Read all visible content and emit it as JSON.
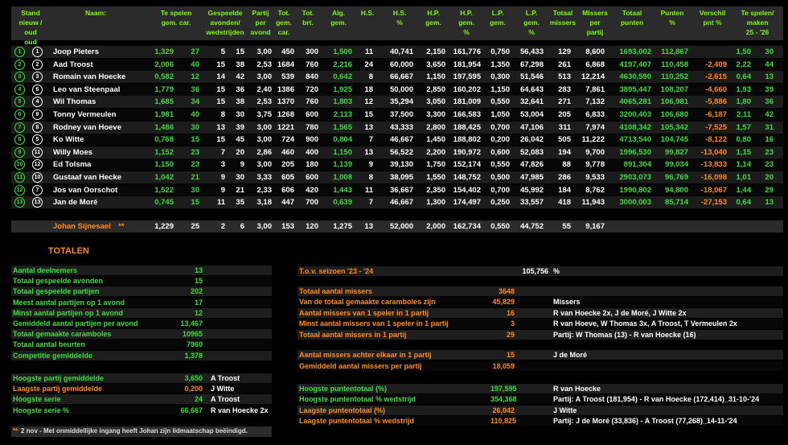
{
  "colors": {
    "green": "#3ddc3d",
    "orange": "#ff8c1a",
    "header_text": "#7CFC00"
  },
  "headers": {
    "stand": "Stand\nnieuw / oud\noud",
    "naam": "Naam:",
    "te_spelen": "Te spelen\ngem.      car.",
    "gespeelde": "Gespeelde\navonden/\nwedstrijden",
    "partij": "Partij\nper\navond",
    "tot_gem": "Tot.\ngem.\ncar.",
    "tot_brt": "Tot.\nbrt.",
    "alg_gem": "Alg.\ngem.",
    "hs": "H.S.",
    "hs_pct": "H.S.\n%",
    "hp_gem": "H.P.\ngem.",
    "hp_pct": "H.P.\ngem.\n%",
    "lp_gem": "L.P.\ngem.",
    "lp_pct": "L.P.\ngem.\n%",
    "totaal_missers": "Totaal\nmissers",
    "missers_per": "Missers\nper\npartij",
    "totaal_punten": "Totaal\npunten",
    "punten_pct": "Punten\n%",
    "verschil": "Verschil\npnt %",
    "te_spelen_maken": "Te spelen/\nmaken\n25 - '26"
  },
  "players": [
    {
      "new": "1",
      "old": "1",
      "name": "Joop Pieters",
      "gem": "1,329",
      "car": "27",
      "av": "5",
      "wd": "15",
      "ppa": "3,00",
      "totcar": "450",
      "brt": "300",
      "alg": "1,500",
      "hs": "11",
      "hspct": "40,741",
      "hp": "2,150",
      "hppct": "161,776",
      "lp": "0,750",
      "lppct": "56,433",
      "miss": "129",
      "missp": "8,600",
      "pnt": "1693,002",
      "pntpct": "112,867",
      "diff": "",
      "tsg": "1,50",
      "tsc": "30"
    },
    {
      "new": "2",
      "old": "2",
      "name": "Aad Troost",
      "gem": "2,006",
      "car": "40",
      "av": "15",
      "wd": "38",
      "ppa": "2,53",
      "totcar": "1684",
      "brt": "760",
      "alg": "2,216",
      "hs": "24",
      "hspct": "60,000",
      "hp": "3,650",
      "hppct": "181,954",
      "lp": "1,350",
      "lppct": "67,298",
      "miss": "261",
      "missp": "6,868",
      "pnt": "4197,407",
      "pntpct": "110,458",
      "diff": "-2,409",
      "tsg": "2,22",
      "tsc": "44"
    },
    {
      "new": "3",
      "old": "3",
      "name": "Romain van Hoecke",
      "gem": "0,582",
      "car": "12",
      "av": "14",
      "wd": "42",
      "ppa": "3,00",
      "totcar": "539",
      "brt": "840",
      "alg": "0,642",
      "hs": "8",
      "hspct": "66,667",
      "hp": "1,150",
      "hppct": "197,595",
      "lp": "0,300",
      "lppct": "51,546",
      "miss": "513",
      "missp": "12,214",
      "pnt": "4630,590",
      "pntpct": "110,252",
      "diff": "-2,615",
      "tsg": "0,64",
      "tsc": "13"
    },
    {
      "new": "4",
      "old": "6",
      "name": "Leo van Steenpaal",
      "gem": "1,779",
      "car": "36",
      "av": "15",
      "wd": "36",
      "ppa": "2,40",
      "totcar": "1386",
      "brt": "720",
      "alg": "1,925",
      "hs": "18",
      "hspct": "50,000",
      "hp": "2,850",
      "hppct": "160,202",
      "lp": "1,150",
      "lppct": "64,643",
      "miss": "283",
      "missp": "7,861",
      "pnt": "3895,447",
      "pntpct": "108,207",
      "diff": "-4,660",
      "tsg": "1,93",
      "tsc": "39"
    },
    {
      "new": "5",
      "old": "4",
      "name": "Wil Thomas",
      "gem": "1,685",
      "car": "34",
      "av": "15",
      "wd": "38",
      "ppa": "2,53",
      "totcar": "1370",
      "brt": "760",
      "alg": "1,803",
      "hs": "12",
      "hspct": "35,294",
      "hp": "3,050",
      "hppct": "181,009",
      "lp": "0,550",
      "lppct": "32,641",
      "miss": "271",
      "missp": "7,132",
      "pnt": "4065,281",
      "pntpct": "106,981",
      "diff": "-5,886",
      "tsg": "1,80",
      "tsc": "36"
    },
    {
      "new": "6",
      "old": "9",
      "name": "Tonny Vermeulen",
      "gem": "1,981",
      "car": "40",
      "av": "8",
      "wd": "30",
      "ppa": "3,75",
      "totcar": "1268",
      "brt": "600",
      "alg": "2,113",
      "hs": "15",
      "hspct": "37,500",
      "hp": "3,300",
      "hppct": "166,583",
      "lp": "1,050",
      "lppct": "53,004",
      "miss": "205",
      "missp": "6,833",
      "pnt": "3200,403",
      "pntpct": "106,680",
      "diff": "-6,187",
      "tsg": "2,11",
      "tsc": "42"
    },
    {
      "new": "7",
      "old": "8",
      "name": "Rodney van Hoeve",
      "gem": "1,486",
      "car": "30",
      "av": "13",
      "wd": "39",
      "ppa": "3,00",
      "totcar": "1221",
      "brt": "780",
      "alg": "1,565",
      "hs": "13",
      "hspct": "43,333",
      "hp": "2,800",
      "hppct": "188,425",
      "lp": "0,700",
      "lppct": "47,106",
      "miss": "311",
      "missp": "7,974",
      "pnt": "4108,342",
      "pntpct": "105,342",
      "diff": "-7,525",
      "tsg": "1,57",
      "tsc": "31"
    },
    {
      "new": "8",
      "old": "5",
      "name": "Ko Witte",
      "gem": "0,768",
      "car": "15",
      "av": "15",
      "wd": "45",
      "ppa": "3,00",
      "totcar": "724",
      "brt": "900",
      "alg": "0,804",
      "hs": "7",
      "hspct": "46,667",
      "hp": "1,450",
      "hppct": "188,802",
      "lp": "0,200",
      "lppct": "26,042",
      "miss": "505",
      "missp": "11,222",
      "pnt": "4713,540",
      "pntpct": "104,745",
      "diff": "-8,122",
      "tsg": "0,80",
      "tsc": "16"
    },
    {
      "new": "9",
      "old": "11",
      "name": "Willy Moes",
      "gem": "1,152",
      "car": "23",
      "av": "7",
      "wd": "20",
      "ppa": "2,86",
      "totcar": "460",
      "brt": "400",
      "alg": "1,150",
      "hs": "13",
      "hspct": "56,522",
      "hp": "2,200",
      "hppct": "190,972",
      "lp": "0,600",
      "lppct": "52,083",
      "miss": "194",
      "missp": "9,700",
      "pnt": "1996,530",
      "pntpct": "99,827",
      "diff": "-13,040",
      "tsg": "1,15",
      "tsc": "23"
    },
    {
      "new": "10",
      "old": "12",
      "name": "Ed Tolsma",
      "gem": "1,150",
      "car": "23",
      "av": "3",
      "wd": "9",
      "ppa": "3,00",
      "totcar": "205",
      "brt": "180",
      "alg": "1,139",
      "hs": "9",
      "hspct": "39,130",
      "hp": "1,750",
      "hppct": "152,174",
      "lp": "0,550",
      "lppct": "47,826",
      "miss": "88",
      "missp": "9,778",
      "pnt": "891,304",
      "pntpct": "99,034",
      "diff": "-13,833",
      "tsg": "1,14",
      "tsc": "23"
    },
    {
      "new": "11",
      "old": "10",
      "name": "Gustaaf van Hecke",
      "gem": "1,042",
      "car": "21",
      "av": "9",
      "wd": "30",
      "ppa": "3,33",
      "totcar": "605",
      "brt": "600",
      "alg": "1,008",
      "hs": "8",
      "hspct": "38,095",
      "hp": "1,550",
      "hppct": "148,752",
      "lp": "0,500",
      "lppct": "47,985",
      "miss": "286",
      "missp": "9,533",
      "pnt": "2903,073",
      "pntpct": "96,769",
      "diff": "-16,098",
      "tsg": "1,01",
      "tsc": "20"
    },
    {
      "new": "12",
      "old": "7",
      "name": "Jos van Oorschot",
      "gem": "1,522",
      "car": "30",
      "av": "9",
      "wd": "21",
      "ppa": "2,33",
      "totcar": "606",
      "brt": "420",
      "alg": "1,443",
      "hs": "11",
      "hspct": "36,667",
      "hp": "2,350",
      "hppct": "154,402",
      "lp": "0,700",
      "lppct": "45,992",
      "miss": "184",
      "missp": "8,762",
      "pnt": "1990,802",
      "pntpct": "94,800",
      "diff": "-18,067",
      "tsg": "1,44",
      "tsc": "29"
    },
    {
      "new": "13",
      "old": "13",
      "name": "Jan de Moré",
      "gem": "0,745",
      "car": "15",
      "av": "11",
      "wd": "35",
      "ppa": "3,18",
      "totcar": "447",
      "brt": "700",
      "alg": "0,639",
      "hs": "7",
      "hspct": "46,667",
      "hp": "1,300",
      "hppct": "174,497",
      "lp": "0,250",
      "lppct": "33,557",
      "miss": "418",
      "missp": "11,943",
      "pnt": "3000,003",
      "pntpct": "85,714",
      "diff": "-27,153",
      "tsg": "0,64",
      "tsc": "13"
    }
  ],
  "guest": {
    "name": "Johan Sijnesael",
    "stars": "**",
    "gem": "1,229",
    "car": "25",
    "av": "2",
    "wd": "6",
    "ppa": "3,00",
    "totcar": "153",
    "brt": "120",
    "alg": "1,275",
    "hs": "13",
    "hspct": "52,000",
    "hp": "2,000",
    "hppct": "162,734",
    "lp": "0,550",
    "lppct": "44,752",
    "miss": "55",
    "missp": "9,167"
  },
  "totalen_title": "TOTALEN",
  "left_stats": [
    {
      "label": "Aantal deelnemers",
      "value": "13",
      "extra": ""
    },
    {
      "label": "Totaal gespeelde avonden",
      "value": "15",
      "extra": ""
    },
    {
      "label": "Totaal gespeelde partijen",
      "value": "202",
      "extra": ""
    },
    {
      "label": "Meest aantal partijen op 1 avond",
      "value": "17",
      "extra": ""
    },
    {
      "label": "Minst aantal partijen op 1 avond",
      "value": "12",
      "extra": ""
    },
    {
      "label": "Gemiddeld aantal partijen per avond",
      "value": "13,467",
      "extra": ""
    },
    {
      "label": "Totaal gemaakte caramboles",
      "value": "10965",
      "extra": ""
    },
    {
      "label": "Totaal aantal beurten",
      "value": "7960",
      "extra": ""
    },
    {
      "label": "Competitie gemiddelde",
      "value": "1,378",
      "extra": ""
    }
  ],
  "left_stats2": [
    {
      "label": "Hoogste partij gemiddelde",
      "value": "3,650",
      "extra": "A Troost",
      "color": "green"
    },
    {
      "label": "Laagste partij gemiddelde",
      "value": "0,200",
      "extra": "J Witte",
      "color": "orange"
    },
    {
      "label": "Hoogste serie",
      "value": "24",
      "extra": "A Troost",
      "color": "green"
    },
    {
      "label": "Hoogste serie %",
      "value": "66,667",
      "extra": "R van Hoecke 2x",
      "color": "green"
    }
  ],
  "seizoen": {
    "label": "T.o.v. seizoen '23 - '24",
    "value": "105,756",
    "unit": "%"
  },
  "right_stats": [
    {
      "label": "Totaal aantal missers",
      "value": "3648",
      "extra": "",
      "color": "orange"
    },
    {
      "label": "Van de totaal gemaakte caramboles zijn",
      "value": "45,829",
      "extra": "Missers",
      "color": "orange"
    },
    {
      "label": "Aantal missers van 1 speler in 1 partij",
      "value": "16",
      "extra": "R van Hoecke 2x, J de Moré, J Witte 2x",
      "color": "orange"
    },
    {
      "label": "Minst aantal missers van 1 speler in 1 partij",
      "value": "3",
      "extra": "R van Hoeve, W Thomas 3x, A Troost, T Vermeulen 2x",
      "color": "orange"
    },
    {
      "label": "Totaal aantal missers in 1 partij",
      "value": "29",
      "extra": "Partij: W Thomas (13) - R van Hoecke (16)",
      "color": "orange"
    }
  ],
  "right_stats2": [
    {
      "label": "Aantal missers achter elkaar in 1 partij",
      "value": "15",
      "extra": "J de Moré",
      "color": "orange"
    },
    {
      "label": "Gemiddeld aantal missers per partij",
      "value": "18,059",
      "extra": "",
      "color": "orange"
    }
  ],
  "right_stats3": [
    {
      "label": "Hoogste puntentotaal (%)",
      "value": "197,595",
      "extra": "R van Hoecke",
      "color": "green"
    },
    {
      "label": "Hoogste puntentotaal % wedstrijd",
      "value": "354,368",
      "extra": "Partij: A Troost (181,954) - R van Hoecke (172,414)_31-10-'24",
      "color": "green"
    },
    {
      "label": "Laagste puntentotaal (%)",
      "value": "26,042",
      "extra": "J Witte",
      "color": "orange"
    },
    {
      "label": "Laagste puntentotaal % wedstrijd",
      "value": "110,825",
      "extra": "Partij: J de Moré (33,836) - A Troost (77,268)_14-11-'24",
      "color": "orange"
    }
  ],
  "footnote": {
    "stars": "**",
    "text": " 2 nov - Met onmiddellijke ingang heeft Johan zijn lidmaatschap beëindigd."
  }
}
